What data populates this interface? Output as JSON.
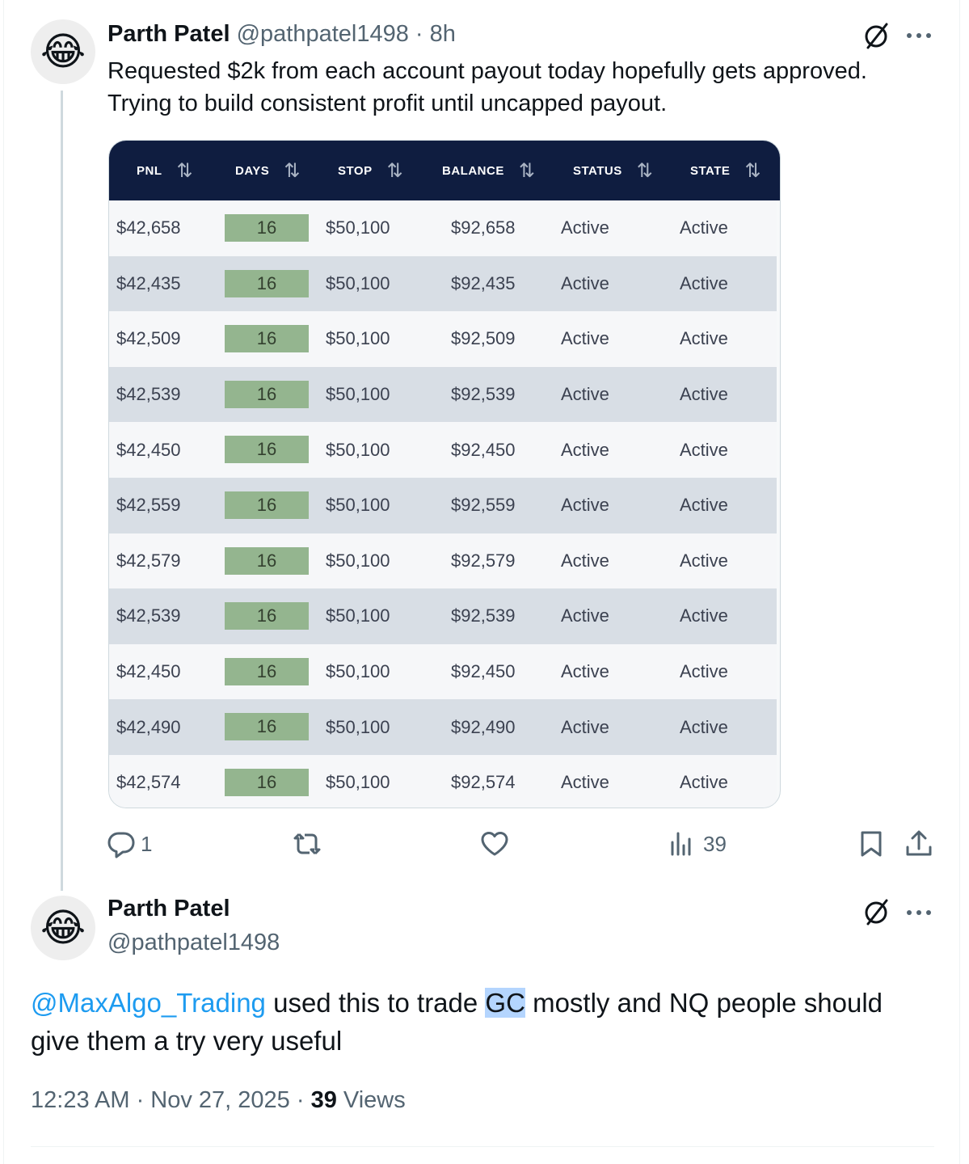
{
  "tweet": {
    "author_name": "Parth Patel",
    "author_handle": "@pathpatel1498",
    "separator": "·",
    "time_ago": "8h",
    "text_line1": "Requested $2k from each account payout today hopefully gets approved.",
    "text_line2": "Trying to build consistent profit until uncapped payout.",
    "avatar_emoji": "😂",
    "table": {
      "headers": [
        "PNL",
        "DAYS",
        "STOP",
        "BALANCE",
        "STATUS",
        "STATE"
      ],
      "sort_glyph": "⇅",
      "rows": [
        {
          "pnl": "$42,658",
          "days": "16",
          "stop": "$50,100",
          "balance": "$92,658",
          "status": "Active",
          "state": "Active"
        },
        {
          "pnl": "$42,435",
          "days": "16",
          "stop": "$50,100",
          "balance": "$92,435",
          "status": "Active",
          "state": "Active"
        },
        {
          "pnl": "$42,509",
          "days": "16",
          "stop": "$50,100",
          "balance": "$92,509",
          "status": "Active",
          "state": "Active"
        },
        {
          "pnl": "$42,539",
          "days": "16",
          "stop": "$50,100",
          "balance": "$92,539",
          "status": "Active",
          "state": "Active"
        },
        {
          "pnl": "$42,450",
          "days": "16",
          "stop": "$50,100",
          "balance": "$92,450",
          "status": "Active",
          "state": "Active"
        },
        {
          "pnl": "$42,559",
          "days": "16",
          "stop": "$50,100",
          "balance": "$92,559",
          "status": "Active",
          "state": "Active"
        },
        {
          "pnl": "$42,579",
          "days": "16",
          "stop": "$50,100",
          "balance": "$92,579",
          "status": "Active",
          "state": "Active"
        },
        {
          "pnl": "$42,539",
          "days": "16",
          "stop": "$50,100",
          "balance": "$92,539",
          "status": "Active",
          "state": "Active"
        },
        {
          "pnl": "$42,450",
          "days": "16",
          "stop": "$50,100",
          "balance": "$92,450",
          "status": "Active",
          "state": "Active"
        },
        {
          "pnl": "$42,490",
          "days": "16",
          "stop": "$50,100",
          "balance": "$92,490",
          "status": "Active",
          "state": "Active"
        },
        {
          "pnl": "$42,574",
          "days": "16",
          "stop": "$50,100",
          "balance": "$92,574",
          "status": "Active",
          "state": "Active"
        }
      ]
    },
    "actions": {
      "reply_count": "1",
      "views_count": "39"
    }
  },
  "reply": {
    "author_name": "Parth Patel",
    "author_handle": "@pathpatel1498",
    "avatar_emoji": "😂",
    "mention": "@MaxAlgo_Trading",
    "text_before_highlight": " used this to trade ",
    "highlight": "GC",
    "text_after_highlight": " mostly and NQ people should",
    "text_line2": "give them a try very useful",
    "timestamp": "12:23 AM · Nov 27, 2025 · ",
    "views_count": "39",
    "views_label": " Views"
  },
  "icons": {
    "top_right_1": "grok-slash-icon",
    "top_right_2": "more-icon",
    "reply": "reply-icon",
    "repost": "repost-icon",
    "like": "like-icon",
    "views": "views-icon",
    "bookmark": "bookmark-icon",
    "share": "share-icon"
  },
  "colors": {
    "link": "#1d9bf0",
    "table_header": "#0f1d40",
    "days_cell": "#94b58f",
    "row_alt": "#d8dee5",
    "highlight": "#b4d5fe"
  }
}
